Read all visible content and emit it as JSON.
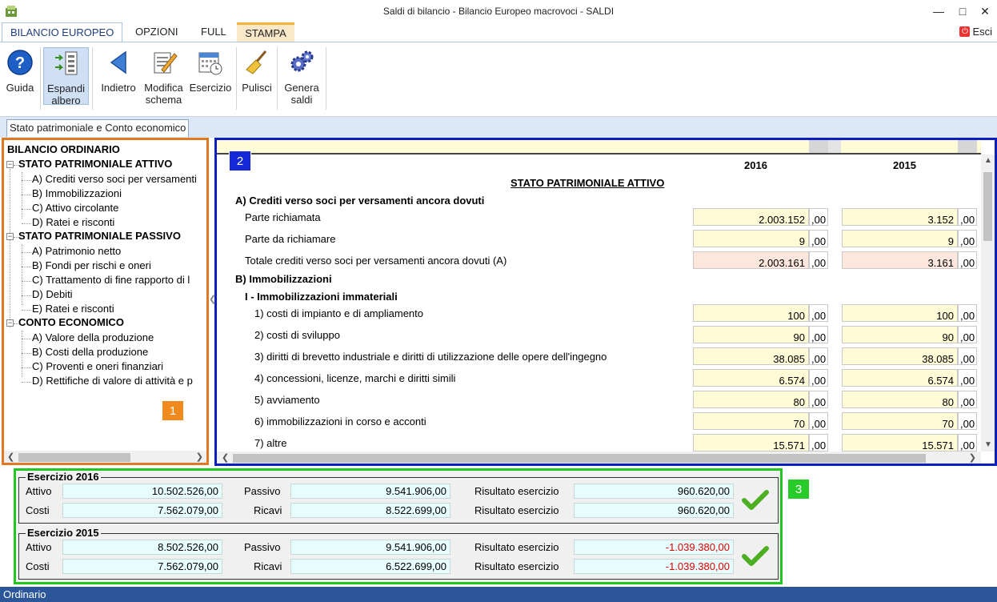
{
  "window": {
    "title": "Saldi di bilancio - Bilancio Europeo macrovoci - SALDI"
  },
  "menu": {
    "tabs": [
      "BILANCIO EUROPEO",
      "OPZIONI",
      "FULL",
      "STAMPA"
    ],
    "exit_label": "Esci"
  },
  "ribbon": {
    "guida": "Guida",
    "espandi_1": "Espandi",
    "espandi_2": "albero",
    "indietro": "Indietro",
    "modifica_1": "Modifica",
    "modifica_2": "schema",
    "esercizio": "Esercizio",
    "pulisci": "Pulisci",
    "genera_1": "Genera",
    "genera_2": "saldi"
  },
  "page_tab": "Stato patrimoniale e Conto economico",
  "tree": {
    "root": "BILANCIO ORDINARIO",
    "attivo": {
      "label": "STATO PATRIMONIALE ATTIVO",
      "items": [
        "A) Crediti verso soci per versamenti",
        "B) Immobilizzazioni",
        "C) Attivo circolante",
        "D) Ratei e risconti"
      ]
    },
    "passivo": {
      "label": "STATO PATRIMONIALE PASSIVO",
      "items": [
        "A) Patrimonio netto",
        "B) Fondi per rischi e oneri",
        "C) Trattamento di fine rapporto di l",
        "D) Debiti",
        "E) Ratei e risconti"
      ]
    },
    "economico": {
      "label": "CONTO ECONOMICO",
      "items": [
        "A) Valore della produzione",
        "B) Costi della produzione",
        "C) Proventi e oneri finanziari",
        "D) Rettifiche di valore di attività e p"
      ]
    }
  },
  "badges": {
    "one": "1",
    "two": "2",
    "three": "3"
  },
  "grid": {
    "year1": "2016",
    "year2": "2015",
    "section_title": "STATO PATRIMONIALE ATTIVO",
    "decimal": ",00",
    "headings": {
      "a": "A) Crediti verso soci per versamenti ancora dovuti",
      "b": "B) Immobilizzazioni",
      "b1": "I - Immobilizzazioni immateriali"
    },
    "rows": [
      {
        "label": "Parte richiamata",
        "v1": "2.003.152",
        "v2": "3.152"
      },
      {
        "label": "Parte da richiamare",
        "v1": "9",
        "v2": "9"
      },
      {
        "label": "Totale crediti verso soci per versamenti ancora dovuti (A)",
        "v1": "2.003.161",
        "v2": "3.161"
      },
      {
        "label": "1) costi di impianto e di ampliamento",
        "v1": "100",
        "v2": "100"
      },
      {
        "label": "2) costi di sviluppo",
        "v1": "90",
        "v2": "90"
      },
      {
        "label": "3) diritti di brevetto industriale e diritti di utilizzazione delle opere dell'ingegno",
        "v1": "38.085",
        "v2": "38.085"
      },
      {
        "label": "4) concessioni, licenze, marchi e diritti simili",
        "v1": "6.574",
        "v2": "6.574"
      },
      {
        "label": "5) avviamento",
        "v1": "80",
        "v2": "80"
      },
      {
        "label": "6) immobilizzazioni in corso e acconti",
        "v1": "70",
        "v2": "70"
      },
      {
        "label": "7) altre",
        "v1": "15.571",
        "v2": "15.571"
      }
    ]
  },
  "summary": {
    "labels": {
      "attivo": "Attivo",
      "passivo": "Passivo",
      "costi": "Costi",
      "ricavi": "Ricavi",
      "risultato": "Risultato esercizio"
    },
    "g2016": {
      "title": "Esercizio 2016",
      "attivo": "10.502.526,00",
      "passivo": "9.541.906,00",
      "risultato1": "960.620,00",
      "costi": "7.562.079,00",
      "ricavi": "8.522.699,00",
      "risultato2": "960.620,00"
    },
    "g2015": {
      "title": "Esercizio 2015",
      "attivo": "8.502.526,00",
      "passivo": "9.541.906,00",
      "risultato1": "-1.039.380,00",
      "costi": "7.562.079,00",
      "ricavi": "6.522.699,00",
      "risultato2": "-1.039.380,00"
    }
  },
  "status": "Ordinario",
  "colors": {
    "accent_orange": "#e07a20",
    "accent_blue": "#0b1ebf",
    "accent_green": "#21c721",
    "negative": "#e00000"
  },
  "icons": [
    "app-icon",
    "minimize-icon",
    "maximize-icon",
    "close-icon",
    "exit-icon",
    "help-icon",
    "expand-tree-icon",
    "back-arrow-icon",
    "edit-schema-icon",
    "calendar-icon",
    "broom-icon",
    "gears-icon",
    "checkmark-icon"
  ]
}
